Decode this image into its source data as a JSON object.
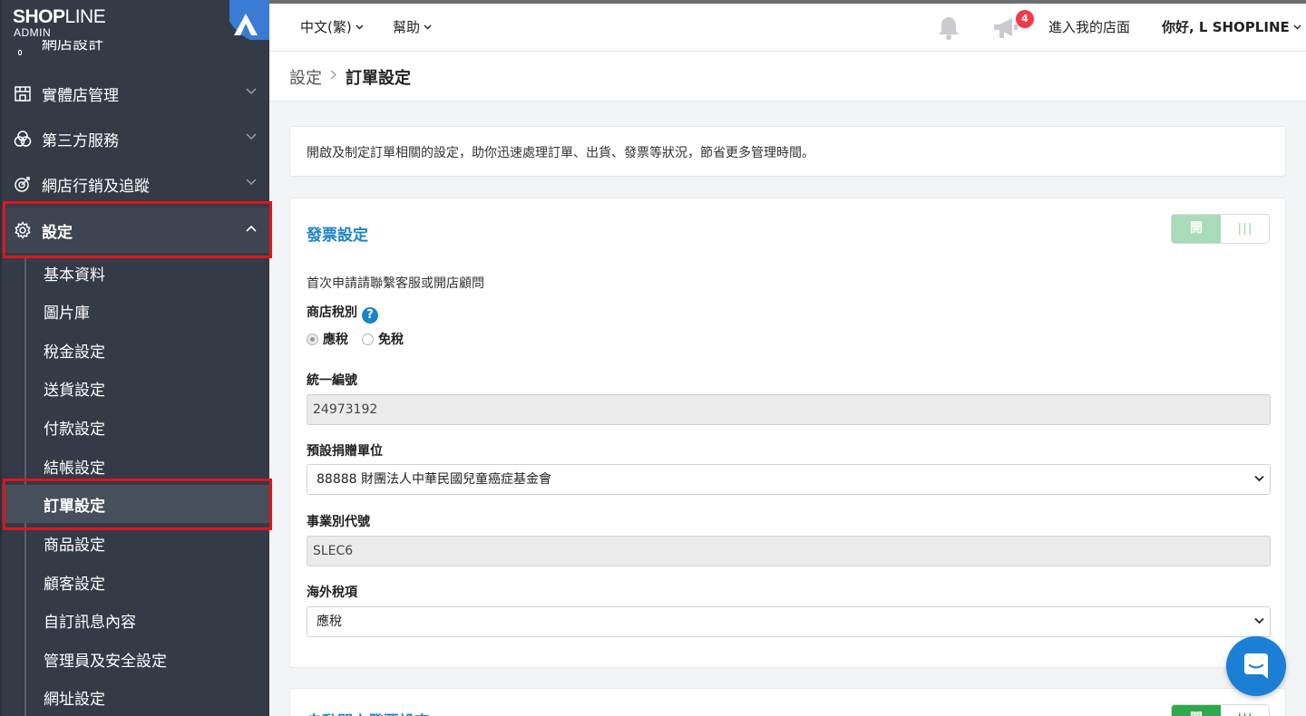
{
  "brand": {
    "name_bold": "SHOP",
    "name_light": "LINE",
    "sub": "ADMIN"
  },
  "sidebar": {
    "cut_item": "網店設計",
    "items": [
      {
        "label": "實體店管理",
        "icon": "store-icon"
      },
      {
        "label": "第三方服務",
        "icon": "circles-icon"
      },
      {
        "label": "網店行銷及追蹤",
        "icon": "target-icon"
      },
      {
        "label": "設定",
        "icon": "gear-icon",
        "active": true
      }
    ],
    "sub_items": [
      "基本資料",
      "圖片庫",
      "稅金設定",
      "送貨設定",
      "付款設定",
      "結帳設定",
      "訂單設定",
      "商品設定",
      "顧客設定",
      "自訂訊息內容",
      "管理員及安全設定",
      "網址設定"
    ],
    "active_sub": "訂單設定"
  },
  "topbar": {
    "language": "中文(繁)",
    "help": "幫助",
    "notification_count": "4",
    "enter_store": "進入我的店面",
    "greeting": "你好, L SHOPLINE"
  },
  "breadcrumb": {
    "parent": "設定",
    "current": "訂單設定"
  },
  "description": "開啟及制定訂單相關的設定，助你迅速處理訂單、出貨、發票等狀況，節省更多管理時間。",
  "invoice": {
    "title": "發票設定",
    "toggle_on": "開",
    "toggle_off": "|||",
    "note": "首次申請請聯繫客服或開店顧問",
    "tax_type_label": "商店稅別",
    "help_glyph": "?",
    "tax_options": [
      "應稅",
      "免稅"
    ],
    "tax_selected": "應稅",
    "unified_number_label": "統一編號",
    "unified_number": "24973192",
    "donation_label": "預設捐贈單位",
    "donation_value": "88888 財團法人中華民國兒童癌症基金會",
    "business_code_label": "事業別代號",
    "business_code": "SLEC6",
    "overseas_tax_label": "海外稅項",
    "overseas_tax_value": "應稅"
  },
  "auto_invoice": {
    "title": "自動開立發票設定",
    "toggle_on": "開",
    "toggle_off": "|||"
  },
  "colors": {
    "sidebar_bg": "#343a46",
    "accent_blue": "#1a84c6",
    "toggle_green": "#a8dbb7",
    "highlight_red": "#e0141b",
    "badge_red": "#f2394a"
  }
}
